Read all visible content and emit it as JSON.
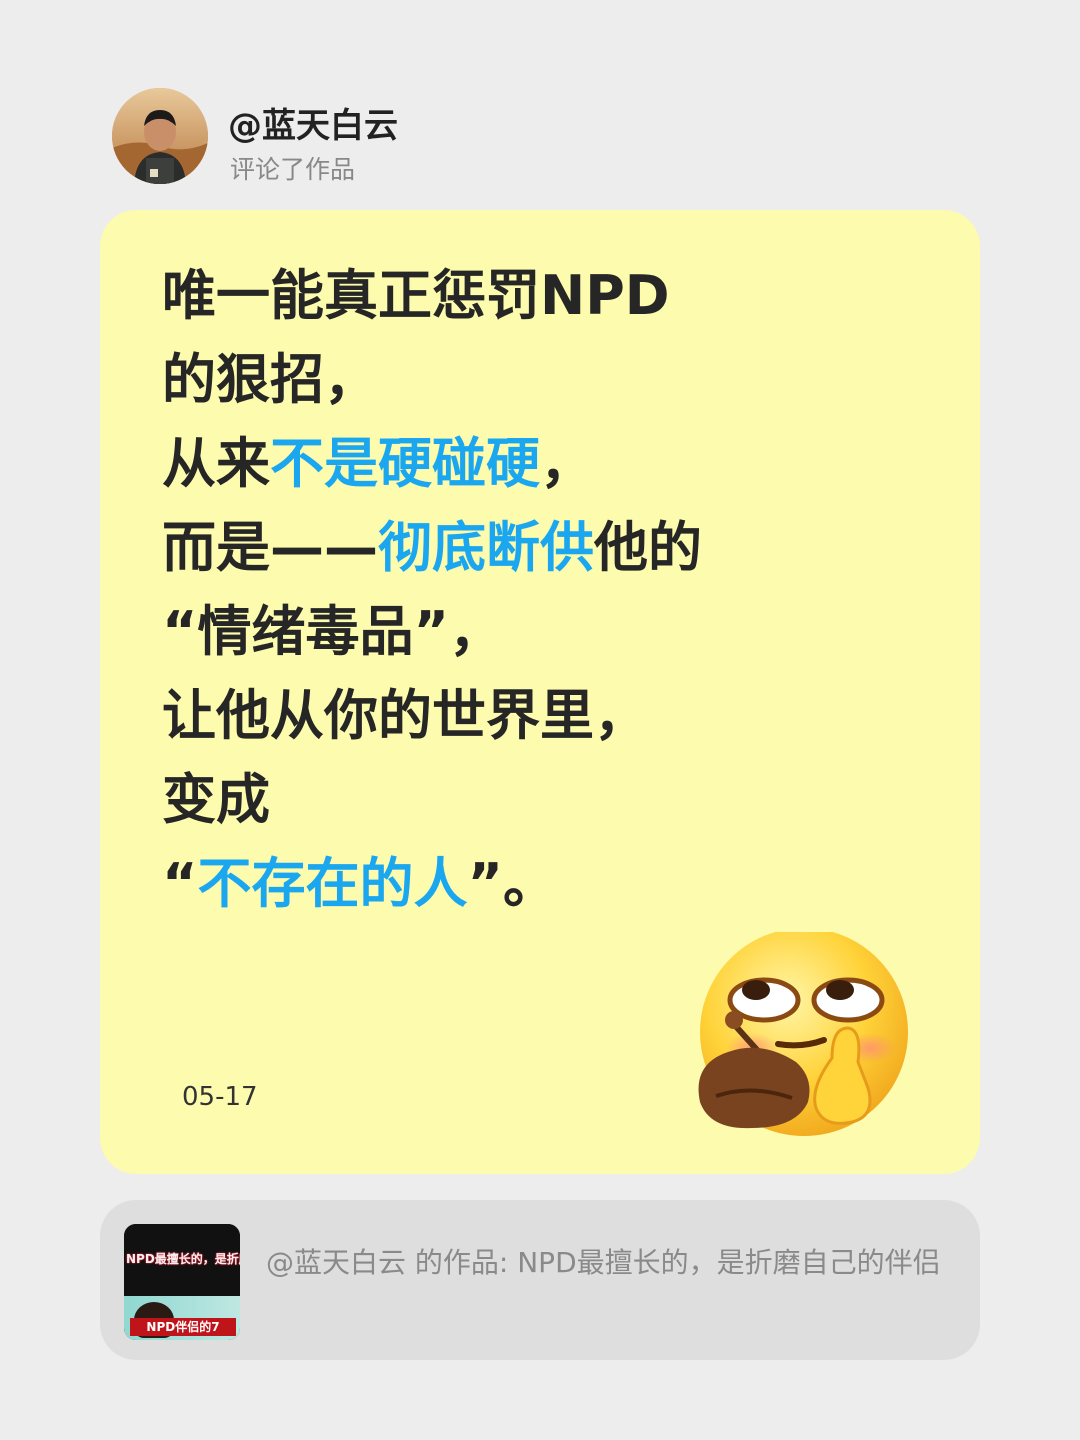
{
  "header": {
    "username": "@蓝天白云",
    "action": "评论了作品"
  },
  "comment": {
    "lines": [
      [
        {
          "text": "唯一能真正惩罚NPD",
          "highlight": false
        }
      ],
      [
        {
          "text": "的狠招，",
          "highlight": false
        }
      ],
      [
        {
          "text": "从来",
          "highlight": false
        },
        {
          "text": "不是硬碰硬",
          "highlight": true
        },
        {
          "text": "，",
          "highlight": false
        }
      ],
      [
        {
          "text": "而是——",
          "highlight": false
        },
        {
          "text": "彻底断供",
          "highlight": true
        },
        {
          "text": "他的",
          "highlight": false
        }
      ],
      [
        {
          "text": "“情绪毒品”，",
          "highlight": false
        }
      ],
      [
        {
          "text": "让他从你的世界里，",
          "highlight": false
        }
      ],
      [
        {
          "text": "变成",
          "highlight": false
        }
      ],
      [
        {
          "text": "“",
          "highlight": false
        },
        {
          "text": "不存在的人",
          "highlight": true
        },
        {
          "text": "”。",
          "highlight": false
        }
      ]
    ],
    "date": "05-17",
    "emoji": "smirk-thinking-emoji",
    "colors": {
      "card_bg": "#fdfbad",
      "text": "#262626",
      "highlight": "#1aa7ef"
    }
  },
  "reference": {
    "thumbnail_text": "NPD最擅长的，是折磨自己的伴侣",
    "thumbnail_banner": "NPD伴侣的7",
    "text": "@蓝天白云 的作品: NPD最擅长的，是折磨自己的伴侣"
  }
}
